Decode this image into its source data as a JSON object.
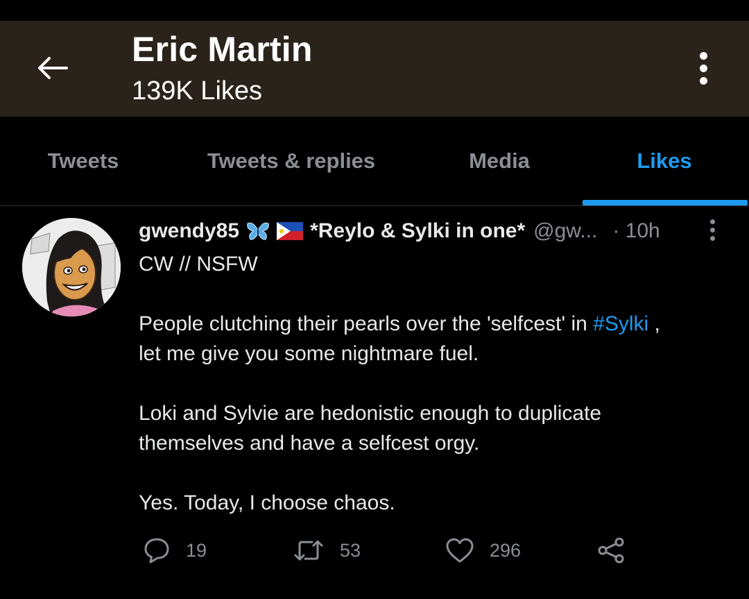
{
  "header": {
    "title": "Eric Martin",
    "subtitle": "139K Likes",
    "back_icon": "arrow-left-icon",
    "more_icon": "vertical-dots-icon"
  },
  "tabs": [
    {
      "label": "Tweets",
      "active": false
    },
    {
      "label": "Tweets & replies",
      "active": false
    },
    {
      "label": "Media",
      "active": false
    },
    {
      "label": "Likes",
      "active": true
    }
  ],
  "colors": {
    "accent": "#1d9bf0",
    "header_bg": "#2a231b",
    "muted_text": "#8b8f94",
    "body_text": "#e7e9ea"
  },
  "tweet": {
    "display_name": "gwendy85",
    "name_emojis": [
      "butterfly-icon",
      "philippines-flag-icon"
    ],
    "display_name_suffix": "*Reylo & Sylki in one*",
    "handle": "@gw...",
    "time": "· 10h",
    "line1": "CW // NSFW",
    "para2_before": "People clutching their pearls over the 'selfcest' in ",
    "para2_hashtag": "#Sylki",
    "para2_after": " ,",
    "para2_line2": "let me give you some nightmare fuel.",
    "para3_line1": "Loki and Sylvie are hedonistic enough to duplicate",
    "para3_line2": "themselves and have a selfcest orgy.",
    "para4": "Yes. Today, I choose chaos.",
    "actions": {
      "reply_count": "19",
      "retweet_count": "53",
      "like_count": "296"
    }
  }
}
